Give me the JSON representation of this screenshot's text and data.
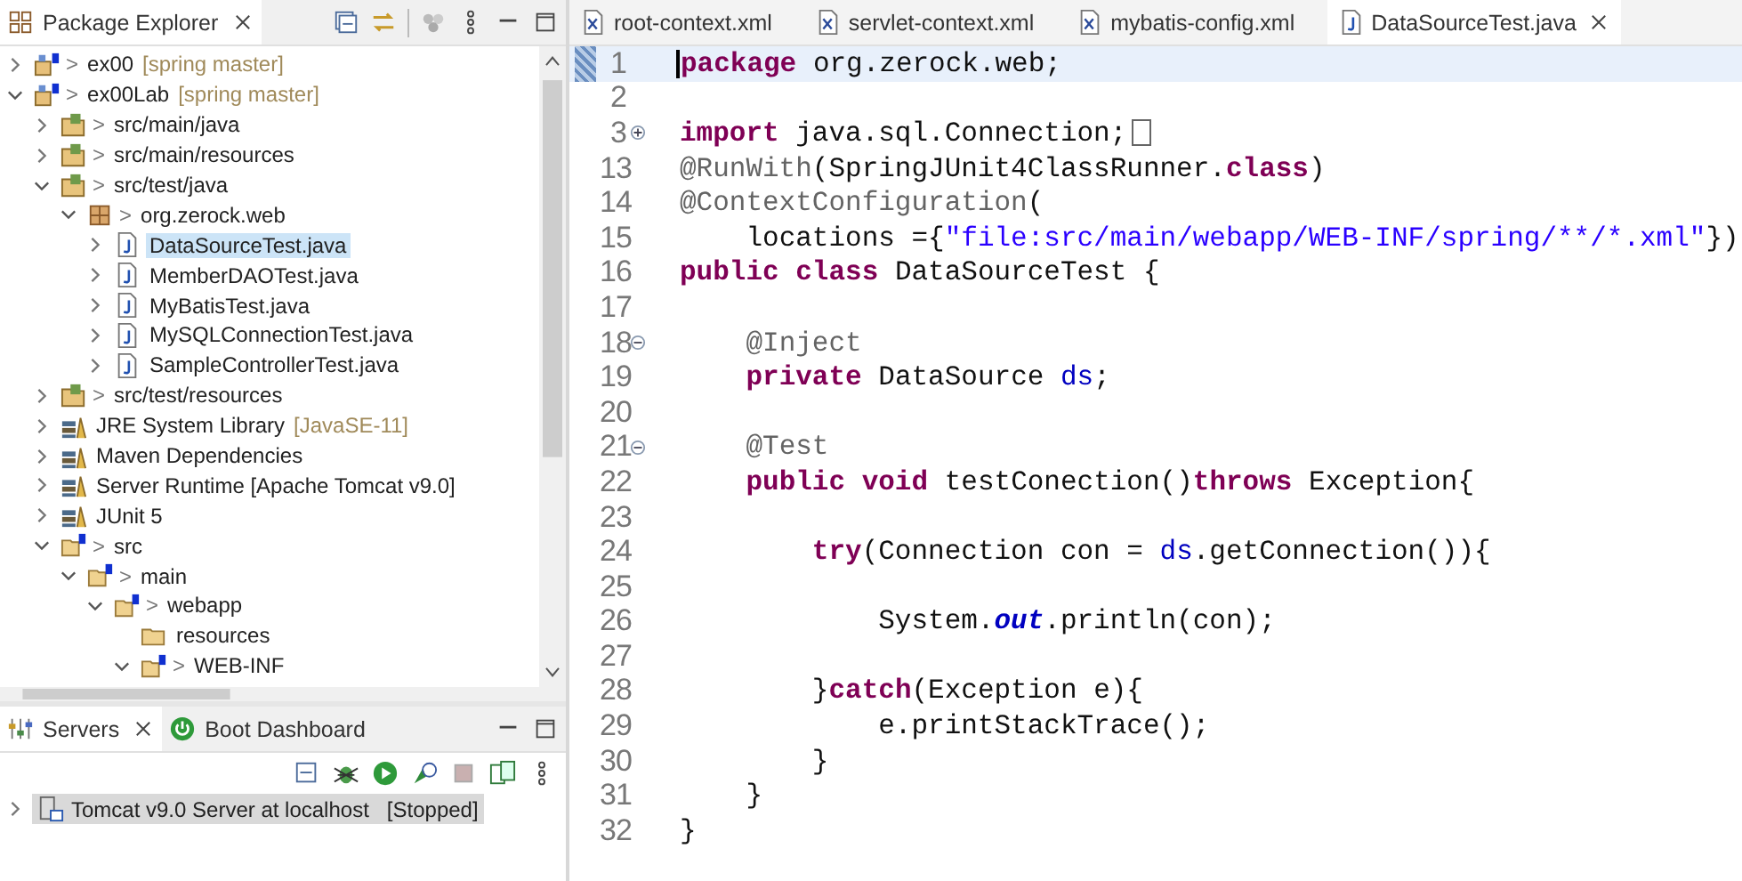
{
  "explorer": {
    "title": "Package Explorer",
    "tree": [
      {
        "label": "ex00",
        "prefix": ">",
        "decoration": "[spring master]",
        "kind": "project",
        "expanded": false,
        "selected": false
      },
      {
        "label": "ex00Lab",
        "prefix": ">",
        "decoration": "[spring master]",
        "kind": "project",
        "expanded": true,
        "selected": false,
        "children": [
          {
            "label": "src/main/java",
            "prefix": ">",
            "kind": "source-folder",
            "expanded": false,
            "selected": false
          },
          {
            "label": "src/main/resources",
            "prefix": ">",
            "kind": "source-folder",
            "expanded": false,
            "selected": false
          },
          {
            "label": "src/test/java",
            "prefix": ">",
            "kind": "source-folder",
            "expanded": true,
            "selected": false,
            "children": [
              {
                "label": "org.zerock.web",
                "prefix": ">",
                "kind": "package",
                "expanded": true,
                "selected": false,
                "children": [
                  {
                    "label": "DataSourceTest.java",
                    "kind": "java-file",
                    "expanded": false,
                    "selected": true
                  },
                  {
                    "label": "MemberDAOTest.java",
                    "kind": "java-file",
                    "expanded": false,
                    "selected": false
                  },
                  {
                    "label": "MyBatisTest.java",
                    "kind": "java-file",
                    "expanded": false,
                    "selected": false
                  },
                  {
                    "label": "MySQLConnectionTest.java",
                    "kind": "java-file",
                    "expanded": false,
                    "selected": false
                  },
                  {
                    "label": "SampleControllerTest.java",
                    "kind": "java-file",
                    "expanded": false,
                    "selected": false
                  }
                ]
              }
            ]
          },
          {
            "label": "src/test/resources",
            "prefix": ">",
            "kind": "source-folder",
            "expanded": false,
            "selected": false
          },
          {
            "label": "JRE System Library",
            "decoration": "[JavaSE-11]",
            "kind": "library",
            "expanded": false,
            "selected": false
          },
          {
            "label": "Maven Dependencies",
            "kind": "library",
            "expanded": false,
            "selected": false
          },
          {
            "label": "Server Runtime [Apache Tomcat v9.0]",
            "kind": "library",
            "expanded": false,
            "selected": false
          },
          {
            "label": "JUnit 5",
            "kind": "library",
            "expanded": false,
            "selected": false
          },
          {
            "label": "src",
            "prefix": ">",
            "kind": "spring-folder",
            "expanded": true,
            "selected": false,
            "children": [
              {
                "label": "main",
                "prefix": ">",
                "kind": "spring-folder",
                "expanded": true,
                "selected": false,
                "children": [
                  {
                    "label": "webapp",
                    "prefix": ">",
                    "kind": "spring-folder",
                    "expanded": true,
                    "selected": false,
                    "children": [
                      {
                        "label": "resources",
                        "kind": "folder",
                        "selected": false
                      },
                      {
                        "label": "WEB-INF",
                        "prefix": ">",
                        "kind": "spring-folder",
                        "expanded": true,
                        "selected": false
                      }
                    ]
                  }
                ]
              }
            ]
          }
        ]
      }
    ]
  },
  "bottom": {
    "tabs": [
      {
        "label": "Servers",
        "kind": "servers",
        "selected": true
      },
      {
        "label": "Boot Dashboard",
        "kind": "boot",
        "selected": false
      }
    ],
    "servers": [
      {
        "label": "Tomcat v9.0 Server at localhost",
        "status": "[Stopped]",
        "expanded": false,
        "selected": true
      }
    ]
  },
  "editor": {
    "tabs": [
      {
        "label": "root-context.xml",
        "kind": "xml",
        "selected": false
      },
      {
        "label": "servlet-context.xml",
        "kind": "xml",
        "selected": false
      },
      {
        "label": "mybatis-config.xml",
        "kind": "xml",
        "selected": false
      },
      {
        "label": "DataSourceTest.java",
        "kind": "java",
        "selected": true
      }
    ],
    "lines": [
      {
        "number": "1",
        "kind": "plain",
        "current": true,
        "tokens": [
          {
            "text": "package",
            "kind": "keyword"
          },
          {
            "text": " org.zerock.web;",
            "kind": "plain"
          }
        ]
      },
      {
        "number": "2",
        "kind": "plain",
        "current": false
      },
      {
        "number": "3",
        "kind": "folded",
        "current": false,
        "tokens": [
          {
            "text": "import",
            "kind": "keyword"
          },
          {
            "text": " java.sql.Connection;",
            "kind": "plain"
          }
        ]
      },
      {
        "number": "13",
        "kind": "plain",
        "current": false,
        "tokens": [
          {
            "text": "@RunWith",
            "kind": "annotation"
          },
          {
            "text": "(SpringJUnit4ClassRunner.",
            "kind": "plain"
          },
          {
            "text": "class",
            "kind": "keyword"
          },
          {
            "text": ")",
            "kind": "plain"
          }
        ]
      },
      {
        "number": "14",
        "kind": "plain",
        "current": false,
        "tokens": [
          {
            "text": "@ContextConfiguration",
            "kind": "annotation"
          },
          {
            "text": "(",
            "kind": "plain"
          }
        ]
      },
      {
        "number": "15",
        "kind": "plain",
        "current": false,
        "tokens": [
          {
            "text": "    locations ={",
            "kind": "plain"
          },
          {
            "text": "\"file:src/main/webapp/WEB-INF/spring/**/*.xml\"",
            "kind": "string"
          },
          {
            "text": "})",
            "kind": "plain"
          }
        ]
      },
      {
        "number": "16",
        "kind": "plain",
        "current": false,
        "tokens": [
          {
            "text": "public class",
            "kind": "keyword"
          },
          {
            "text": " DataSourceTest {",
            "kind": "plain"
          }
        ]
      },
      {
        "number": "17",
        "kind": "plain",
        "current": false
      },
      {
        "number": "18",
        "kind": "foldable",
        "current": false,
        "tokens": [
          {
            "text": "    @Inject",
            "kind": "annotation"
          }
        ]
      },
      {
        "number": "19",
        "kind": "plain",
        "current": false,
        "tokens": [
          {
            "text": "    private",
            "kind": "keyword"
          },
          {
            "text": " DataSource ",
            "kind": "plain"
          },
          {
            "text": "ds",
            "kind": "field"
          },
          {
            "text": ";",
            "kind": "plain"
          }
        ]
      },
      {
        "number": "20",
        "kind": "plain",
        "current": false
      },
      {
        "number": "21",
        "kind": "foldable",
        "current": false,
        "tokens": [
          {
            "text": "    @Test",
            "kind": "annotation"
          }
        ]
      },
      {
        "number": "22",
        "kind": "plain",
        "current": false,
        "tokens": [
          {
            "text": "    public void",
            "kind": "keyword"
          },
          {
            "text": " testConection()",
            "kind": "plain"
          },
          {
            "text": "throws",
            "kind": "keyword"
          },
          {
            "text": " Exception{",
            "kind": "plain"
          }
        ]
      },
      {
        "number": "23",
        "kind": "plain",
        "current": false
      },
      {
        "number": "24",
        "kind": "plain",
        "current": false,
        "tokens": [
          {
            "text": "        try",
            "kind": "keyword"
          },
          {
            "text": "(Connection con = ",
            "kind": "plain"
          },
          {
            "text": "ds",
            "kind": "field"
          },
          {
            "text": ".getConnection()){",
            "kind": "plain"
          }
        ]
      },
      {
        "number": "25",
        "kind": "plain",
        "current": false
      },
      {
        "number": "26",
        "kind": "plain",
        "current": false,
        "tokens": [
          {
            "text": "            System.",
            "kind": "plain"
          },
          {
            "text": "out",
            "kind": "static"
          },
          {
            "text": ".println(con);",
            "kind": "plain"
          }
        ]
      },
      {
        "number": "27",
        "kind": "plain",
        "current": false
      },
      {
        "number": "28",
        "kind": "plain",
        "current": false,
        "tokens": [
          {
            "text": "        }",
            "kind": "plain"
          },
          {
            "text": "catch",
            "kind": "keyword"
          },
          {
            "text": "(Exception e){",
            "kind": "plain"
          }
        ]
      },
      {
        "number": "29",
        "kind": "plain",
        "current": false,
        "tokens": [
          {
            "text": "            e.printStackTrace();",
            "kind": "plain"
          }
        ]
      },
      {
        "number": "30",
        "kind": "plain",
        "current": false,
        "tokens": [
          {
            "text": "        }",
            "kind": "plain"
          }
        ]
      },
      {
        "number": "31",
        "kind": "plain",
        "current": false,
        "tokens": [
          {
            "text": "    }",
            "kind": "plain"
          }
        ]
      },
      {
        "number": "32",
        "kind": "plain",
        "current": false,
        "tokens": [
          {
            "text": "}",
            "kind": "plain"
          }
        ]
      }
    ]
  }
}
